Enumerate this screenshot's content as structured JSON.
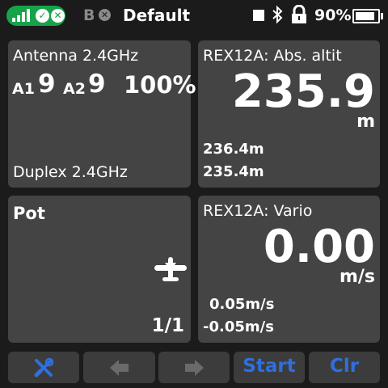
{
  "status": {
    "model_letter": "B",
    "model_name": "Default",
    "battery_pct": "90%"
  },
  "antenna": {
    "title": "Antenna 2.4GHz",
    "a1_label": "A1",
    "a1_value": "9",
    "a2_label": "A2",
    "a2_value": "9",
    "quality": "100%",
    "mode": "Duplex 2.4GHz"
  },
  "altitude": {
    "title": "REX12A: Abs. altit",
    "value": "235.9",
    "unit": "m",
    "max": "236.4m",
    "min": "235.4m"
  },
  "pot": {
    "title": "Pot",
    "page": "1/1"
  },
  "vario": {
    "title": "REX12A: Vario",
    "value": "0.00",
    "unit": "m/s",
    "max": "0.05m/s",
    "min": "-0.05m/s"
  },
  "buttons": {
    "start": "Start",
    "clr": "Clr"
  },
  "colors": {
    "accent": "#2f6fde",
    "ok_green": "#17a34a",
    "widget_bg": "#444444",
    "screen_bg": "#1b1b1b"
  },
  "icons": [
    "signal-icon",
    "check-icon",
    "close-icon",
    "bluetooth-icon",
    "lock-icon",
    "battery-icon",
    "tools-icon",
    "arrow-left-icon",
    "arrow-right-icon",
    "airplane-icon"
  ]
}
